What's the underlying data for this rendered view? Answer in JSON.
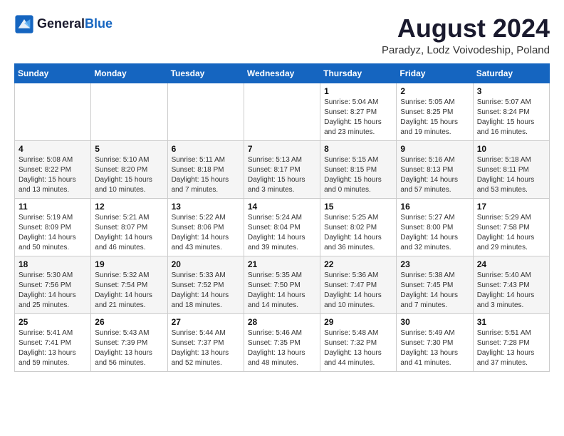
{
  "header": {
    "logo_line1": "General",
    "logo_line2": "Blue",
    "month_year": "August 2024",
    "location": "Paradyz, Lodz Voivodeship, Poland"
  },
  "days_of_week": [
    "Sunday",
    "Monday",
    "Tuesday",
    "Wednesday",
    "Thursday",
    "Friday",
    "Saturday"
  ],
  "weeks": [
    [
      {
        "day": "",
        "info": ""
      },
      {
        "day": "",
        "info": ""
      },
      {
        "day": "",
        "info": ""
      },
      {
        "day": "",
        "info": ""
      },
      {
        "day": "1",
        "info": "Sunrise: 5:04 AM\nSunset: 8:27 PM\nDaylight: 15 hours\nand 23 minutes."
      },
      {
        "day": "2",
        "info": "Sunrise: 5:05 AM\nSunset: 8:25 PM\nDaylight: 15 hours\nand 19 minutes."
      },
      {
        "day": "3",
        "info": "Sunrise: 5:07 AM\nSunset: 8:24 PM\nDaylight: 15 hours\nand 16 minutes."
      }
    ],
    [
      {
        "day": "4",
        "info": "Sunrise: 5:08 AM\nSunset: 8:22 PM\nDaylight: 15 hours\nand 13 minutes."
      },
      {
        "day": "5",
        "info": "Sunrise: 5:10 AM\nSunset: 8:20 PM\nDaylight: 15 hours\nand 10 minutes."
      },
      {
        "day": "6",
        "info": "Sunrise: 5:11 AM\nSunset: 8:18 PM\nDaylight: 15 hours\nand 7 minutes."
      },
      {
        "day": "7",
        "info": "Sunrise: 5:13 AM\nSunset: 8:17 PM\nDaylight: 15 hours\nand 3 minutes."
      },
      {
        "day": "8",
        "info": "Sunrise: 5:15 AM\nSunset: 8:15 PM\nDaylight: 15 hours\nand 0 minutes."
      },
      {
        "day": "9",
        "info": "Sunrise: 5:16 AM\nSunset: 8:13 PM\nDaylight: 14 hours\nand 57 minutes."
      },
      {
        "day": "10",
        "info": "Sunrise: 5:18 AM\nSunset: 8:11 PM\nDaylight: 14 hours\nand 53 minutes."
      }
    ],
    [
      {
        "day": "11",
        "info": "Sunrise: 5:19 AM\nSunset: 8:09 PM\nDaylight: 14 hours\nand 50 minutes."
      },
      {
        "day": "12",
        "info": "Sunrise: 5:21 AM\nSunset: 8:07 PM\nDaylight: 14 hours\nand 46 minutes."
      },
      {
        "day": "13",
        "info": "Sunrise: 5:22 AM\nSunset: 8:06 PM\nDaylight: 14 hours\nand 43 minutes."
      },
      {
        "day": "14",
        "info": "Sunrise: 5:24 AM\nSunset: 8:04 PM\nDaylight: 14 hours\nand 39 minutes."
      },
      {
        "day": "15",
        "info": "Sunrise: 5:25 AM\nSunset: 8:02 PM\nDaylight: 14 hours\nand 36 minutes."
      },
      {
        "day": "16",
        "info": "Sunrise: 5:27 AM\nSunset: 8:00 PM\nDaylight: 14 hours\nand 32 minutes."
      },
      {
        "day": "17",
        "info": "Sunrise: 5:29 AM\nSunset: 7:58 PM\nDaylight: 14 hours\nand 29 minutes."
      }
    ],
    [
      {
        "day": "18",
        "info": "Sunrise: 5:30 AM\nSunset: 7:56 PM\nDaylight: 14 hours\nand 25 minutes."
      },
      {
        "day": "19",
        "info": "Sunrise: 5:32 AM\nSunset: 7:54 PM\nDaylight: 14 hours\nand 21 minutes."
      },
      {
        "day": "20",
        "info": "Sunrise: 5:33 AM\nSunset: 7:52 PM\nDaylight: 14 hours\nand 18 minutes."
      },
      {
        "day": "21",
        "info": "Sunrise: 5:35 AM\nSunset: 7:50 PM\nDaylight: 14 hours\nand 14 minutes."
      },
      {
        "day": "22",
        "info": "Sunrise: 5:36 AM\nSunset: 7:47 PM\nDaylight: 14 hours\nand 10 minutes."
      },
      {
        "day": "23",
        "info": "Sunrise: 5:38 AM\nSunset: 7:45 PM\nDaylight: 14 hours\nand 7 minutes."
      },
      {
        "day": "24",
        "info": "Sunrise: 5:40 AM\nSunset: 7:43 PM\nDaylight: 14 hours\nand 3 minutes."
      }
    ],
    [
      {
        "day": "25",
        "info": "Sunrise: 5:41 AM\nSunset: 7:41 PM\nDaylight: 13 hours\nand 59 minutes."
      },
      {
        "day": "26",
        "info": "Sunrise: 5:43 AM\nSunset: 7:39 PM\nDaylight: 13 hours\nand 56 minutes."
      },
      {
        "day": "27",
        "info": "Sunrise: 5:44 AM\nSunset: 7:37 PM\nDaylight: 13 hours\nand 52 minutes."
      },
      {
        "day": "28",
        "info": "Sunrise: 5:46 AM\nSunset: 7:35 PM\nDaylight: 13 hours\nand 48 minutes."
      },
      {
        "day": "29",
        "info": "Sunrise: 5:48 AM\nSunset: 7:32 PM\nDaylight: 13 hours\nand 44 minutes."
      },
      {
        "day": "30",
        "info": "Sunrise: 5:49 AM\nSunset: 7:30 PM\nDaylight: 13 hours\nand 41 minutes."
      },
      {
        "day": "31",
        "info": "Sunrise: 5:51 AM\nSunset: 7:28 PM\nDaylight: 13 hours\nand 37 minutes."
      }
    ]
  ]
}
